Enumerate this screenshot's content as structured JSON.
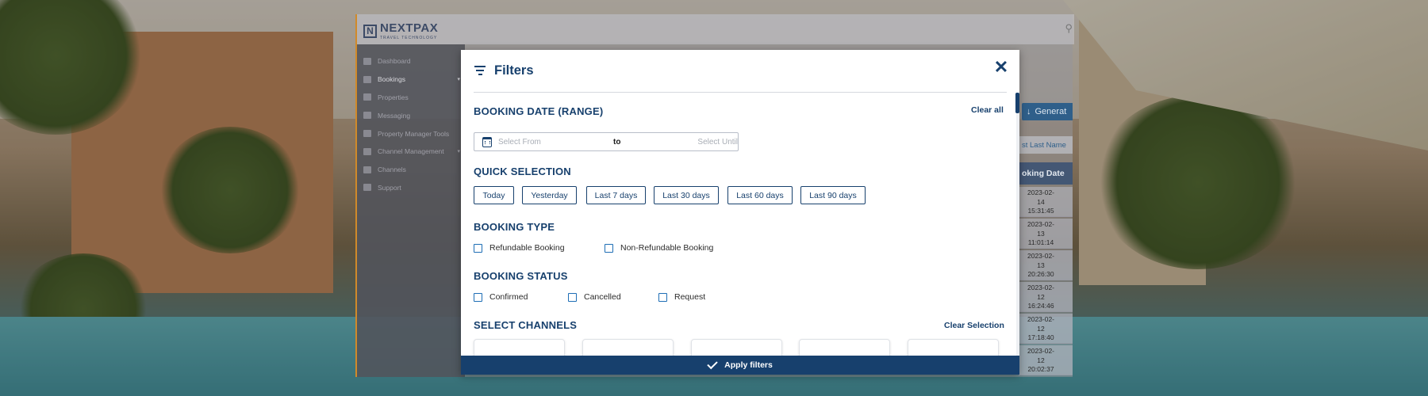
{
  "background": {
    "description_colors": {
      "overlay": "#2a231e"
    }
  },
  "app": {
    "logo_text": "NEXTPAX",
    "logo_subtext": "TRAVEL TECHNOLOGY",
    "sidebar": {
      "items": [
        {
          "label": "Dashboard",
          "icon": "dashboard-icon"
        },
        {
          "label": "Bookings",
          "icon": "bookings-icon",
          "active": true,
          "has_submenu": true
        },
        {
          "label": "Properties",
          "icon": "properties-icon"
        },
        {
          "label": "Messaging",
          "icon": "messaging-icon"
        },
        {
          "label": "Property Manager Tools",
          "icon": "tools-icon"
        },
        {
          "label": "Channel Management",
          "icon": "channel-management-icon",
          "has_submenu": true
        },
        {
          "label": "Channels",
          "icon": "channels-icon"
        },
        {
          "label": "Support",
          "icon": "support-icon"
        }
      ]
    },
    "generate_button": "Generat",
    "last_name_filter": "st Last Name",
    "booking_date_header": "oking Date",
    "booking_dates": [
      [
        "2023-02-",
        "14",
        "15:31:45"
      ],
      [
        "2023-02-",
        "13",
        "11:01:14"
      ],
      [
        "2023-02-",
        "13",
        "20:26:30"
      ],
      [
        "2023-02-",
        "12",
        "16:24:46"
      ],
      [
        "2023-02-",
        "12",
        "17:18:40"
      ],
      [
        "2023-02-",
        "12",
        "20:02:37"
      ]
    ]
  },
  "modal": {
    "title": "Filters",
    "booking_date": {
      "title": "BOOKING DATE (RANGE)",
      "clear_all": "Clear all",
      "from_placeholder": "Select From",
      "to_label": "to",
      "until_placeholder": "Select Until"
    },
    "quick_selection": {
      "title": "QUICK SELECTION",
      "options": [
        "Today",
        "Yesterday",
        "Last 7 days",
        "Last 30 days",
        "Last 60 days",
        "Last 90 days"
      ]
    },
    "booking_type": {
      "title": "BOOKING TYPE",
      "options": [
        {
          "label": "Refundable Booking",
          "checked": false
        },
        {
          "label": "Non-Refundable Booking",
          "checked": false
        }
      ]
    },
    "booking_status": {
      "title": "BOOKING STATUS",
      "options": [
        {
          "label": "Confirmed",
          "checked": false
        },
        {
          "label": "Cancelled",
          "checked": false
        },
        {
          "label": "Request",
          "checked": false
        }
      ]
    },
    "channels": {
      "title": "SELECT CHANNELS",
      "clear_selection": "Clear Selection"
    },
    "apply_label": "Apply filters",
    "colors": {
      "primary": "#17406d",
      "checkbox": "#1e6eb5"
    }
  }
}
